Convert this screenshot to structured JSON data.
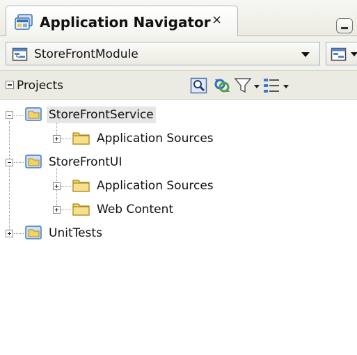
{
  "panel": {
    "title": "Application Navigator",
    "close_glyph": "×",
    "icon": "navigator-icon"
  },
  "module": {
    "selected": "StoreFrontModule",
    "icon": "module-icon"
  },
  "projects_header": {
    "label": "Projects",
    "tools": [
      "find-icon",
      "refresh-icon",
      "filter-icon",
      "options-icon"
    ]
  },
  "tree": {
    "nodes": [
      {
        "label": "StoreFrontService",
        "level": 0,
        "expanded": true,
        "selected": true,
        "icon": "project-folder-icon"
      },
      {
        "label": "Application Sources",
        "level": 1,
        "expanded": false,
        "selected": false,
        "icon": "folder-icon"
      },
      {
        "label": "StoreFrontUI",
        "level": 0,
        "expanded": true,
        "selected": false,
        "icon": "project-folder-icon"
      },
      {
        "label": "Application Sources",
        "level": 1,
        "expanded": false,
        "selected": false,
        "icon": "folder-icon"
      },
      {
        "label": "Web Content",
        "level": 1,
        "expanded": false,
        "selected": false,
        "icon": "folder-icon"
      },
      {
        "label": "UnitTests",
        "level": 0,
        "expanded": false,
        "selected": false,
        "icon": "project-folder-icon"
      }
    ]
  },
  "colors": {
    "folder": "#f2d36a",
    "project_folder_border": "#3c78c8",
    "selection": "#e6e6e6"
  }
}
